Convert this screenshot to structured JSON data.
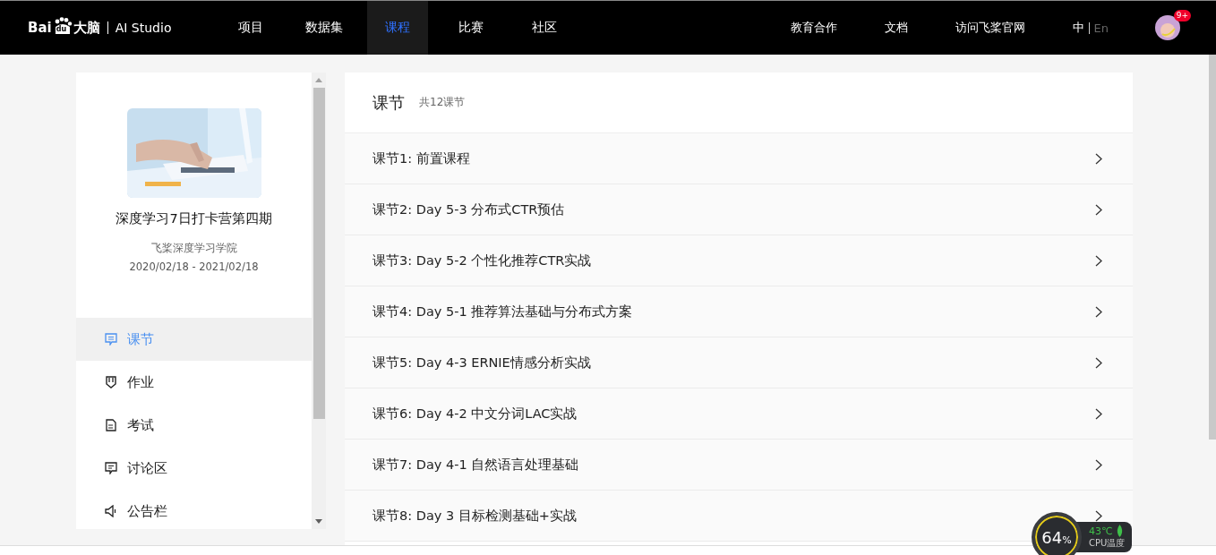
{
  "logo": {
    "brand": "Bai",
    "paw": "du",
    "product": "大脑",
    "name": "AI Studio"
  },
  "nav": [
    {
      "label": "项目",
      "selected": false
    },
    {
      "label": "数据集",
      "selected": false
    },
    {
      "label": "课程",
      "selected": true
    },
    {
      "label": "比赛",
      "selected": false
    },
    {
      "label": "社区",
      "selected": false
    }
  ],
  "right_links": [
    "教育合作",
    "文档",
    "访问飞桨官网"
  ],
  "languages": [
    {
      "label": "中",
      "selected": true
    },
    {
      "label": "En",
      "selected": false
    }
  ],
  "notifications": {
    "badge": "9+"
  },
  "course": {
    "title": "深度学习7日打卡营第四期",
    "org": "飞桨深度学习学院",
    "dates": "2020/02/18 - 2021/02/18"
  },
  "menu": [
    {
      "kind": "lesson",
      "label": "课节",
      "selected": true
    },
    {
      "kind": "homework",
      "label": "作业",
      "selected": false
    },
    {
      "kind": "exam",
      "label": "考试",
      "selected": false
    },
    {
      "kind": "discussion",
      "label": "讨论区",
      "selected": false
    },
    {
      "kind": "notice",
      "label": "公告栏",
      "selected": false
    }
  ],
  "lessons_panel": {
    "title": "课节",
    "count": "共12课节",
    "lessons": [
      "课节1: 前置课程",
      "课节2: Day 5-3 分布式CTR预估",
      "课节3: Day 5-2 个性化推荐CTR实战",
      "课节4: Day 5-1 推荐算法基础与分布式方案",
      "课节5: Day 4-3 ERNIE情感分析实战",
      "课节6: Day 4-2 中文分词LAC实战",
      "课节7: Day 4-1 自然语言处理基础",
      "课节8: Day 3 目标检测基础+实战"
    ]
  },
  "cpu_widget": {
    "load": "64",
    "unit": "%",
    "temperature": "43℃",
    "label": "CPU温度"
  }
}
